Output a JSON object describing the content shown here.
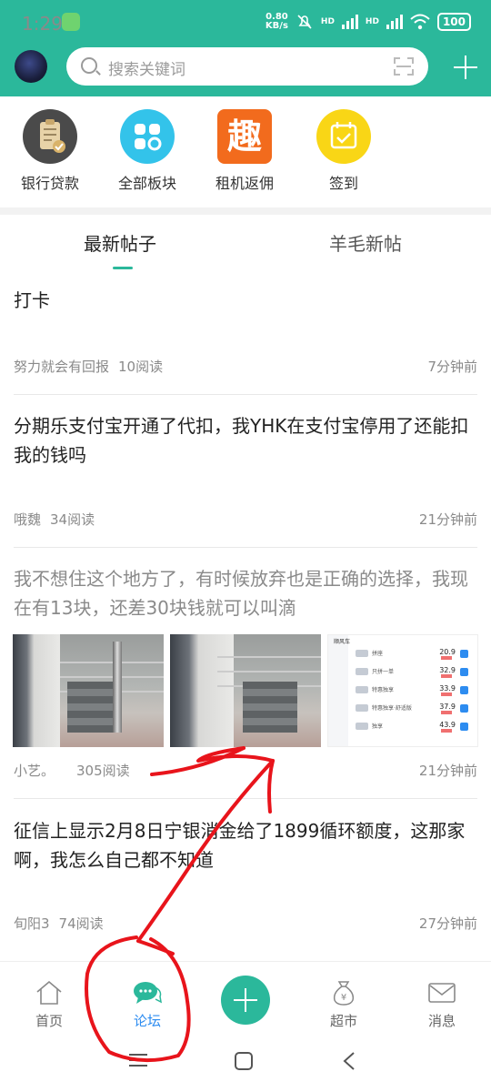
{
  "status_bar": {
    "time": "1:29",
    "net_speed_value": "0.80",
    "net_speed_unit": "KB/s",
    "sim1": "HD",
    "sim2": "HD",
    "battery": "100"
  },
  "header": {
    "search_placeholder": "搜索关键词"
  },
  "quick_links": [
    {
      "label": "银行贷款",
      "icon": "clipboard-check-icon",
      "color": "#4a4a4a"
    },
    {
      "label": "全部板块",
      "icon": "grid-blocks-icon",
      "color": "#33c3ea"
    },
    {
      "label": "租机返佣",
      "icon": "qu-character-icon",
      "color": "#f26b1d",
      "glyph": "趣"
    },
    {
      "label": "签到",
      "icon": "calendar-check-icon",
      "color": "#f9d616"
    }
  ],
  "tabs": [
    {
      "label": "最新帖子",
      "active": true
    },
    {
      "label": "羊毛新帖",
      "active": false
    }
  ],
  "posts": [
    {
      "title": "打卡",
      "author": "努力就会有回报",
      "reads": "10阅读",
      "time": "7分钟前"
    },
    {
      "title": "分期乐支付宝开通了代扣，我YHK在支付宝停用了还能扣我的钱吗",
      "author": "哦魏",
      "reads": "34阅读",
      "time": "21分钟前"
    },
    {
      "title": "我不想住这个地方了，有时候放弃也是正确的选择，我现在有13块，还差30块钱就可以叫滴",
      "author": "小艺。",
      "reads": "305阅读",
      "time": "21分钟前",
      "screenshot": {
        "header": "顺风车",
        "rows": [
          {
            "name": "拼座",
            "price": "20.9"
          },
          {
            "name": "只拼一单",
            "price": "32.9"
          },
          {
            "name": "特惠独享",
            "price": "33.9"
          },
          {
            "name": "特惠独享·舒适版",
            "price": "37.9"
          },
          {
            "name": "独享",
            "price": "43.9"
          }
        ]
      }
    },
    {
      "title": "征信上显示2月8日宁银消金给了1899循环额度，这那家啊，我怎么自己都不知道",
      "author": "旬阳3",
      "reads": "74阅读",
      "time": "27分钟前"
    }
  ],
  "bottom_nav": [
    {
      "label": "首页",
      "icon": "home-icon",
      "active": false
    },
    {
      "label": "论坛",
      "icon": "chat-bubble-icon",
      "active": true
    },
    {
      "label": "超市",
      "icon": "money-bag-icon",
      "active": false
    },
    {
      "label": "消息",
      "icon": "mail-icon",
      "active": false
    }
  ],
  "colors": {
    "brand": "#2bb89b",
    "active_nav": "#2d8cf0",
    "annotation": "#e8141b"
  }
}
